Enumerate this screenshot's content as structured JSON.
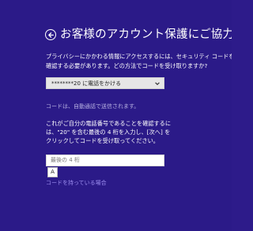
{
  "header": {
    "title": "お客様のアカウント保護にご協力ください"
  },
  "description": {
    "line1": "プライバシーにかかわる情報にアクセスするには、セキュリティ コードを使ってアカウ",
    "line2": "確認する必要があります。どの方法でコードを受け取りますか?"
  },
  "method": {
    "selected": "********20 に電話をかける"
  },
  "auto_note": "コードは、自動通話で送信されます。",
  "instructions": {
    "line1": "これがご自分の電話番号であることを確認するに",
    "line2": "は、\"20\" を含む最後の 4 桁を入力し、[次へ] を",
    "line3": "クリックしてコードを受け取ってください。"
  },
  "code_input": {
    "placeholder": "最後の 4 桁"
  },
  "ime_indicator": "A",
  "have_code_link": "コードを持っている場合"
}
